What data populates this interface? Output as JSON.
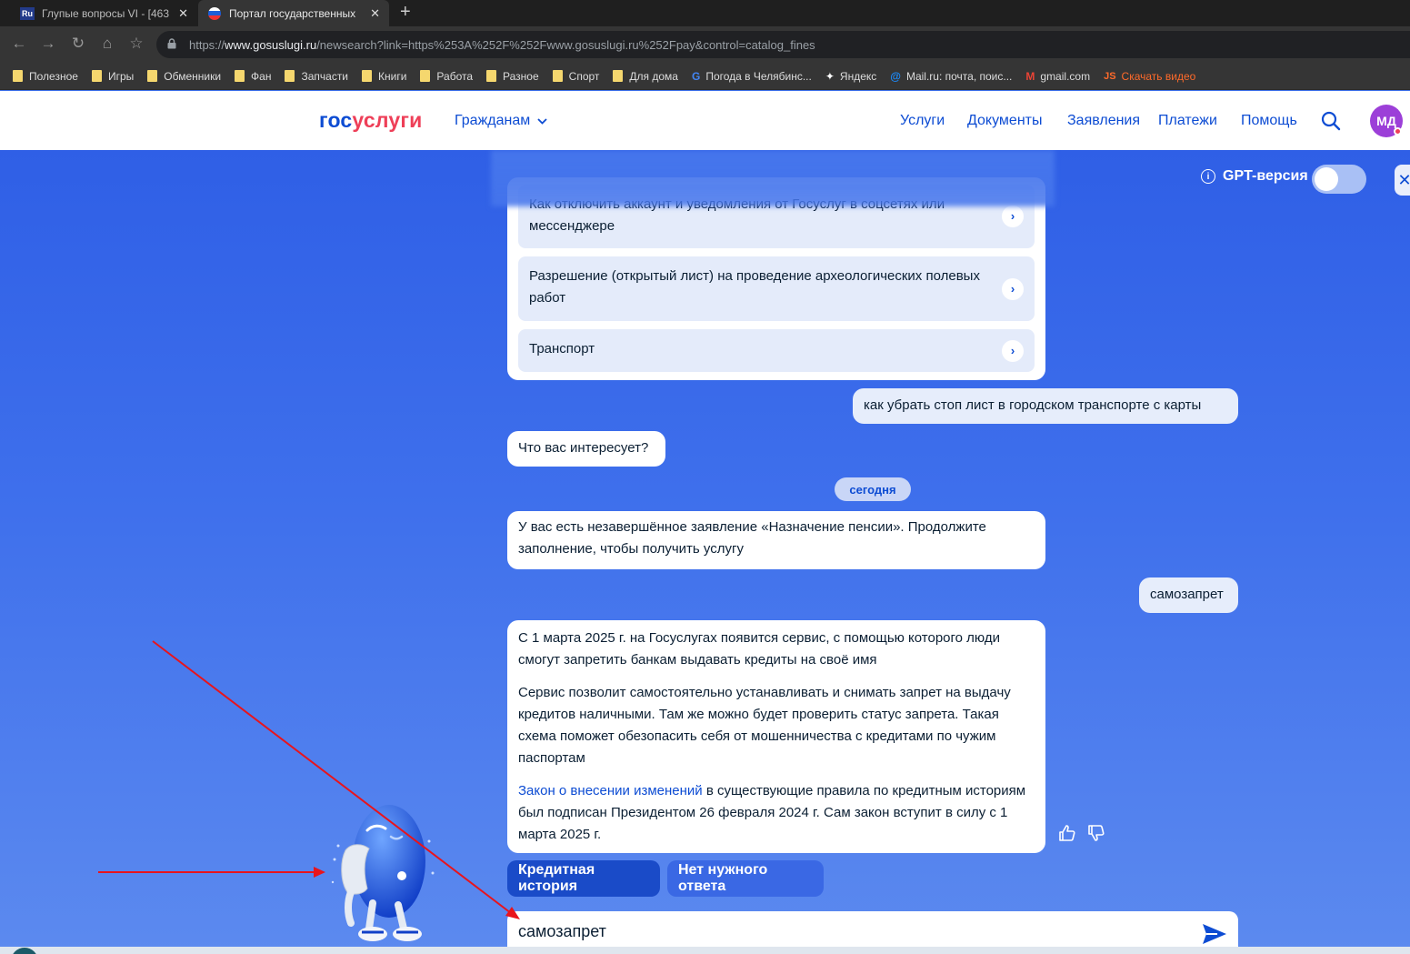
{
  "browser": {
    "tabs": [
      {
        "title": "Глупые вопросы VI - [463",
        "favicon": "Ru"
      },
      {
        "title": "Портал государственных",
        "favicon": "flag"
      }
    ],
    "url_prefix": "https://",
    "url_host": "www.gosuslugi.ru",
    "url_path": "/newsearch?link=https%253A%252F%252Fwww.gosuslugi.ru%252Fpay&control=catalog_fines",
    "bookmarks": [
      {
        "label": "Полезное",
        "icon": "folder-icon"
      },
      {
        "label": "Игры",
        "icon": "folder-icon"
      },
      {
        "label": "Обменники",
        "icon": "folder-icon"
      },
      {
        "label": "Фан",
        "icon": "folder-icon"
      },
      {
        "label": "Запчасти",
        "icon": "folder-icon"
      },
      {
        "label": "Книги",
        "icon": "folder-icon"
      },
      {
        "label": "Работа",
        "icon": "folder-icon"
      },
      {
        "label": "Разное",
        "icon": "folder-icon"
      },
      {
        "label": "Спорт",
        "icon": "folder-icon"
      },
      {
        "label": "Для дома",
        "icon": "folder-icon"
      },
      {
        "label": "Погода в Челябинс...",
        "icon": "google-icon"
      },
      {
        "label": "Яндекс",
        "icon": "yandex-icon"
      },
      {
        "label": "Mail.ru: почта, поис...",
        "icon": "mailru-icon"
      },
      {
        "label": "gmail.com",
        "icon": "gmail-icon"
      },
      {
        "label": "Скачать видео",
        "icon": "js-icon"
      }
    ]
  },
  "header": {
    "logo_part1": "гос",
    "logo_part2": "услуги",
    "citizens_label": "Гражданам",
    "nav": [
      "Услуги",
      "Документы",
      "Заявления",
      "Платежи",
      "Помощь"
    ],
    "avatar_initials": "МД"
  },
  "chat": {
    "gpt_label": "GPT-версия",
    "gpt_enabled": false,
    "options": [
      "Как отключить аккаунт и уведомления от Госуслуг в соцсетях или мессенджере",
      "Разрешение (открытый лист) на проведение археологических полевых работ",
      "Транспорт"
    ],
    "user_msg_1": "как убрать стоп лист в городском транспорте с карты",
    "bot_msg_1": "Что вас интересует?",
    "date_label": "сегодня",
    "bot_msg_2": "У вас есть незавершённое заявление «Назначение пенсии». Продолжите заполнение, чтобы получить услугу",
    "user_msg_2": "самозапрет",
    "bot_answer": {
      "p1": "С 1 марта 2025 г. на Госуслугах появится сервис, с помощью которого люди смогут запретить банкам выдавать кредиты на своё имя",
      "p2": "Сервис позволит самостоятельно устанавливать и снимать запрет на выдачу кредитов наличными. Там же можно будет проверить статус запрета. Такая схема поможет обезопасить себя от мошенничества с кредитами по чужим паспортам",
      "p3_link": "Закон о внесении изменений",
      "p3_rest": " в существующие правила по кредитным историям был подписан Президентом 26 февраля 2024 г. Сам закон вступит в силу с 1 марта 2025 г."
    },
    "quick_replies": [
      "Кредитная история",
      "Нет нужного ответа"
    ],
    "input_value": "самозапрет"
  },
  "colors": {
    "brand_blue": "#0d4cd3",
    "brand_red": "#ee3f58",
    "annotation_arrow": "#e8141c"
  }
}
